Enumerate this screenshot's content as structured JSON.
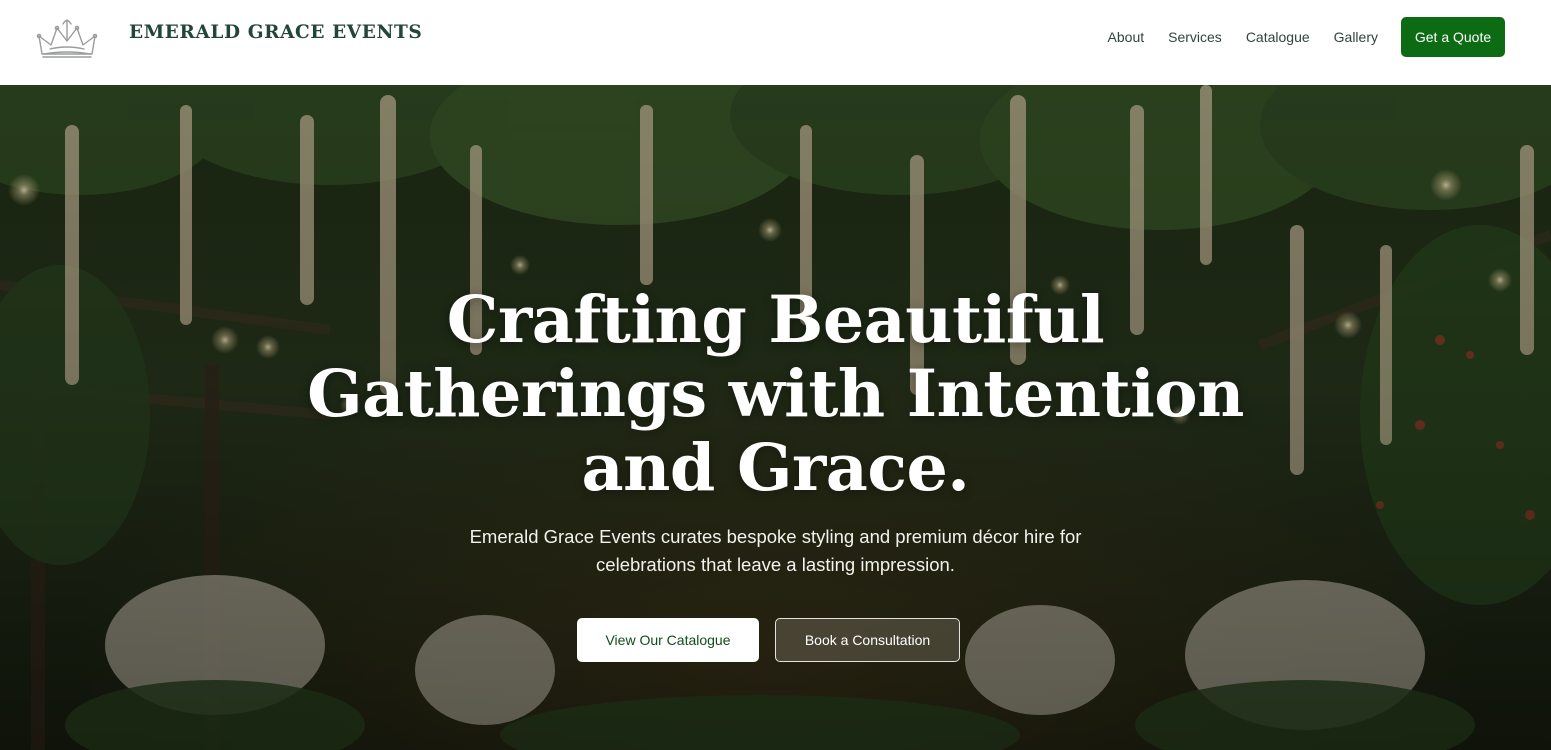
{
  "header": {
    "brand_name": "EMERALD GRACE EVENTS",
    "logo_icon": "crown-icon",
    "nav": [
      {
        "label": "About"
      },
      {
        "label": "Services"
      },
      {
        "label": "Catalogue"
      },
      {
        "label": "Gallery"
      }
    ],
    "cta_label": "Get a Quote"
  },
  "hero": {
    "title_lines": [
      "Crafting Beautiful",
      "Gatherings with Intention",
      "and Grace."
    ],
    "subtitle_lines": [
      "Emerald Grace Events curates bespoke styling and premium décor hire for",
      "celebrations that leave a lasting impression."
    ],
    "primary_button": "View Our Catalogue",
    "secondary_button": "Book a Consultation"
  },
  "colors": {
    "brand_green": "#0d6b13",
    "brand_text": "#23463a",
    "nav_text": "#33433c"
  }
}
